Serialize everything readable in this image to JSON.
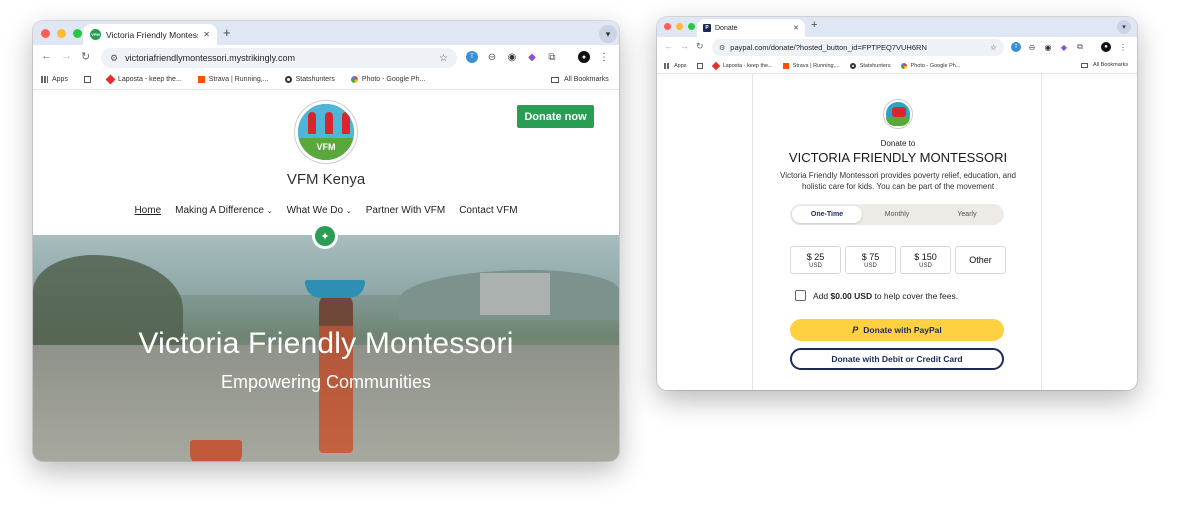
{
  "left_window": {
    "tab_title": "Victoria Friendly Montessori",
    "favicon_text": "VFM",
    "new_tab": "+",
    "tab_close": "✕",
    "url": "victoriafriendlymontessori.mystrikingly.com",
    "bookmarks": {
      "apps": "Apps",
      "items": [
        "Laposta - keep the...",
        "Strava | Running,...",
        "Statshunters",
        "Photo - Google Ph..."
      ],
      "all": "All Bookmarks"
    },
    "page": {
      "logo_text": "VFM",
      "site_title": "VFM Kenya",
      "donate_button": "Donate now",
      "nav": [
        "Home",
        "Making A Difference",
        "What We Do",
        "Partner With VFM",
        "Contact VFM"
      ],
      "hero_title": "Victoria Friendly Montessori",
      "hero_subtitle": "Empowering Communities"
    }
  },
  "right_window": {
    "tab_title": "Donate",
    "favicon_text": "P",
    "new_tab": "+",
    "tab_close": "✕",
    "url": "paypal.com/donate/?hosted_button_id=FPTPEQ7VUH6RN",
    "bookmarks": {
      "apps": "Apps",
      "items": [
        "Laposta - keep the...",
        "Strava | Running,...",
        "Statshunters",
        "Photo - Google Ph..."
      ],
      "all": "All Bookmarks"
    },
    "page": {
      "donate_to": "Donate to",
      "org_name": "VICTORIA FRIENDLY MONTESSORI",
      "description": "Victoria Friendly Montessori provides poverty relief, education, and holistic care for kids. You can be part of the movement",
      "frequency": [
        "One-Time",
        "Monthly",
        "Yearly"
      ],
      "amounts": [
        {
          "amount": "$ 25",
          "currency": "USD"
        },
        {
          "amount": "$ 75",
          "currency": "USD"
        },
        {
          "amount": "$ 150",
          "currency": "USD"
        }
      ],
      "other": "Other",
      "cover_prefix": "Add",
      "cover_amount": "$0.00 USD",
      "cover_suffix": "to help cover the fees.",
      "paypal_button": "Donate with PayPal",
      "card_button": "Donate with Debit or Credit Card"
    }
  },
  "colors": {
    "donate_green": "#2a9d55",
    "paypal_yellow": "#ffd140",
    "paypal_navy": "#1a2b5a",
    "tabstrip": "#dfe6f4"
  }
}
